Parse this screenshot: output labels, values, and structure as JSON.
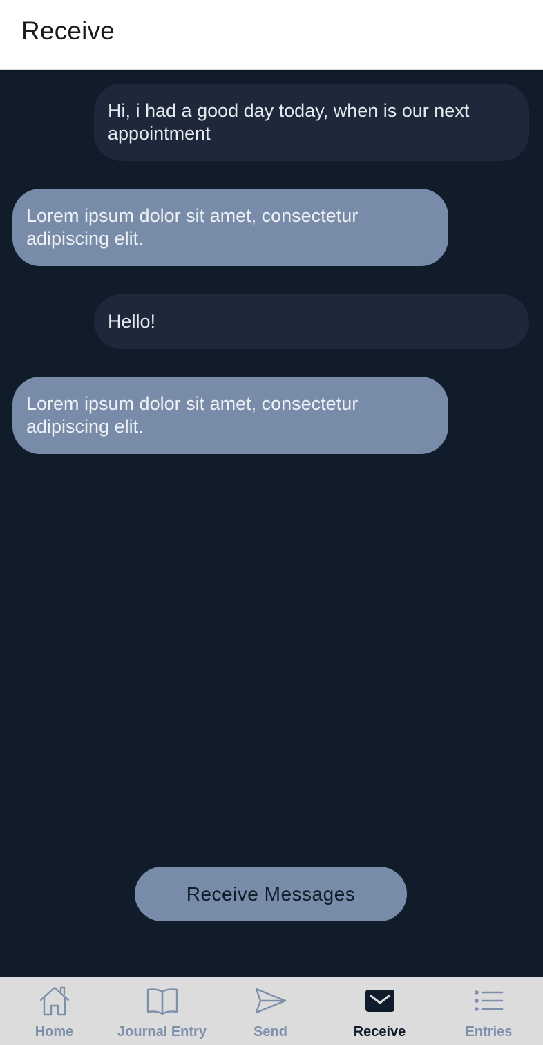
{
  "header": {
    "title": "Receive"
  },
  "messages": [
    {
      "type": "sent",
      "text": "Hi, i had a good day today, when is our next appointment"
    },
    {
      "type": "received",
      "text": "Lorem ipsum dolor sit amet, consectetur adipiscing elit."
    },
    {
      "type": "sent",
      "text": "Hello!"
    },
    {
      "type": "received",
      "text": "Lorem ipsum dolor sit amet, consectetur adipiscing elit."
    }
  ],
  "actions": {
    "receive_label": "Receive Messages"
  },
  "tabbar": {
    "active": "Receive",
    "items": [
      {
        "label": "Home",
        "icon": "home-icon"
      },
      {
        "label": "Journal Entry",
        "icon": "book-icon"
      },
      {
        "label": "Send",
        "icon": "send-icon"
      },
      {
        "label": "Receive",
        "icon": "mail-icon"
      },
      {
        "label": "Entries",
        "icon": "list-icon"
      }
    ]
  },
  "colors": {
    "background": "#111c2b",
    "sent_bubble": "#1d283a",
    "received_bubble": "#788ba8",
    "tab_inactive": "#7d8fab",
    "tab_active": "#111c2b"
  }
}
